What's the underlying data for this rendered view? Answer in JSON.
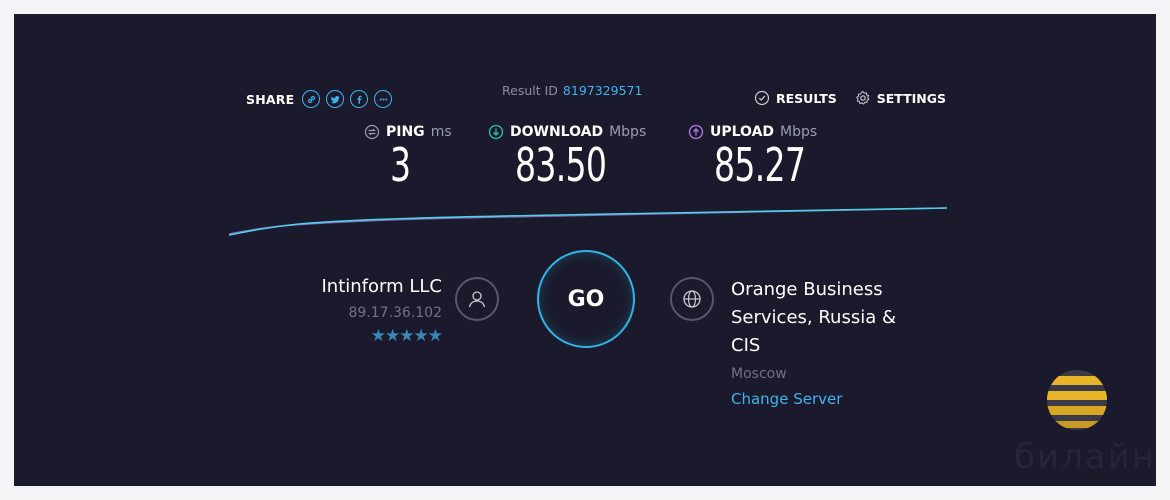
{
  "share": {
    "label": "SHARE",
    "buttons": [
      "link-icon",
      "twitter-icon",
      "facebook-icon",
      "more-icon"
    ]
  },
  "result": {
    "label": "Result ID",
    "id": "8197329571"
  },
  "nav": {
    "results_label": "RESULTS",
    "settings_label": "SETTINGS"
  },
  "metrics": {
    "ping": {
      "label": "PING",
      "unit": "ms",
      "value": "3"
    },
    "download": {
      "label": "DOWNLOAD",
      "unit": "Mbps",
      "value": "83.50"
    },
    "upload": {
      "label": "UPLOAD",
      "unit": "Mbps",
      "value": "85.27"
    }
  },
  "isp": {
    "name": "Intinform LLC",
    "ip": "89.17.36.102",
    "stars": "★★★★★",
    "rating": 5
  },
  "go_label": "GO",
  "server": {
    "name": "Orange Business Services, Russia & CIS",
    "city": "Moscow",
    "change_label": "Change Server"
  },
  "watermark": {
    "text": "билайн"
  },
  "colors": {
    "background": "#1a1a2c",
    "accent": "#3db4ef",
    "download_icon": "#26c6a6",
    "upload_icon": "#b57ce8"
  }
}
